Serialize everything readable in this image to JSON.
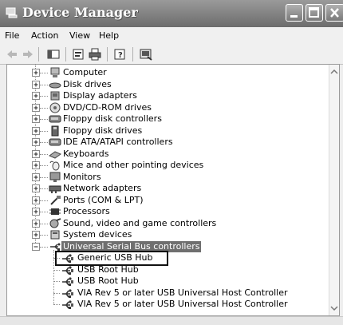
{
  "window": {
    "title": "Device Manager"
  },
  "menu": {
    "items": [
      "File",
      "Action",
      "View",
      "Help"
    ]
  },
  "toolbar": {
    "buttons": [
      "back-icon",
      "forward-icon",
      "show-hide-console-tree-icon",
      "properties-icon",
      "print-icon",
      "help-icon",
      "scan-hardware-icon"
    ]
  },
  "tree": {
    "categories": [
      {
        "label": "Computer",
        "icon": "computer-icon"
      },
      {
        "label": "Disk drives",
        "icon": "disk-drive-icon"
      },
      {
        "label": "Display adapters",
        "icon": "display-adapter-icon"
      },
      {
        "label": "DVD/CD-ROM drives",
        "icon": "dvd-drive-icon"
      },
      {
        "label": "Floppy disk controllers",
        "icon": "floppy-controller-icon"
      },
      {
        "label": "Floppy disk drives",
        "icon": "floppy-drive-icon"
      },
      {
        "label": "IDE ATA/ATAPI controllers",
        "icon": "ide-controller-icon"
      },
      {
        "label": "Keyboards",
        "icon": "keyboard-icon"
      },
      {
        "label": "Mice and other pointing devices",
        "icon": "mouse-icon"
      },
      {
        "label": "Monitors",
        "icon": "monitor-icon"
      },
      {
        "label": "Network adapters",
        "icon": "network-adapter-icon"
      },
      {
        "label": "Ports (COM & LPT)",
        "icon": "port-icon"
      },
      {
        "label": "Processors",
        "icon": "processor-icon"
      },
      {
        "label": "Sound, video and game controllers",
        "icon": "sound-icon"
      },
      {
        "label": "System devices",
        "icon": "system-device-icon"
      }
    ],
    "expanded": {
      "label": "Universal Serial Bus controllers",
      "icon": "usb-icon",
      "children": [
        "Generic USB Hub",
        "USB Root Hub",
        "USB Root Hub",
        "VIA Rev 5 or later USB Universal Host Controller",
        "VIA Rev 5 or later USB Universal Host Controller"
      ],
      "highlighted_child": 0
    }
  }
}
